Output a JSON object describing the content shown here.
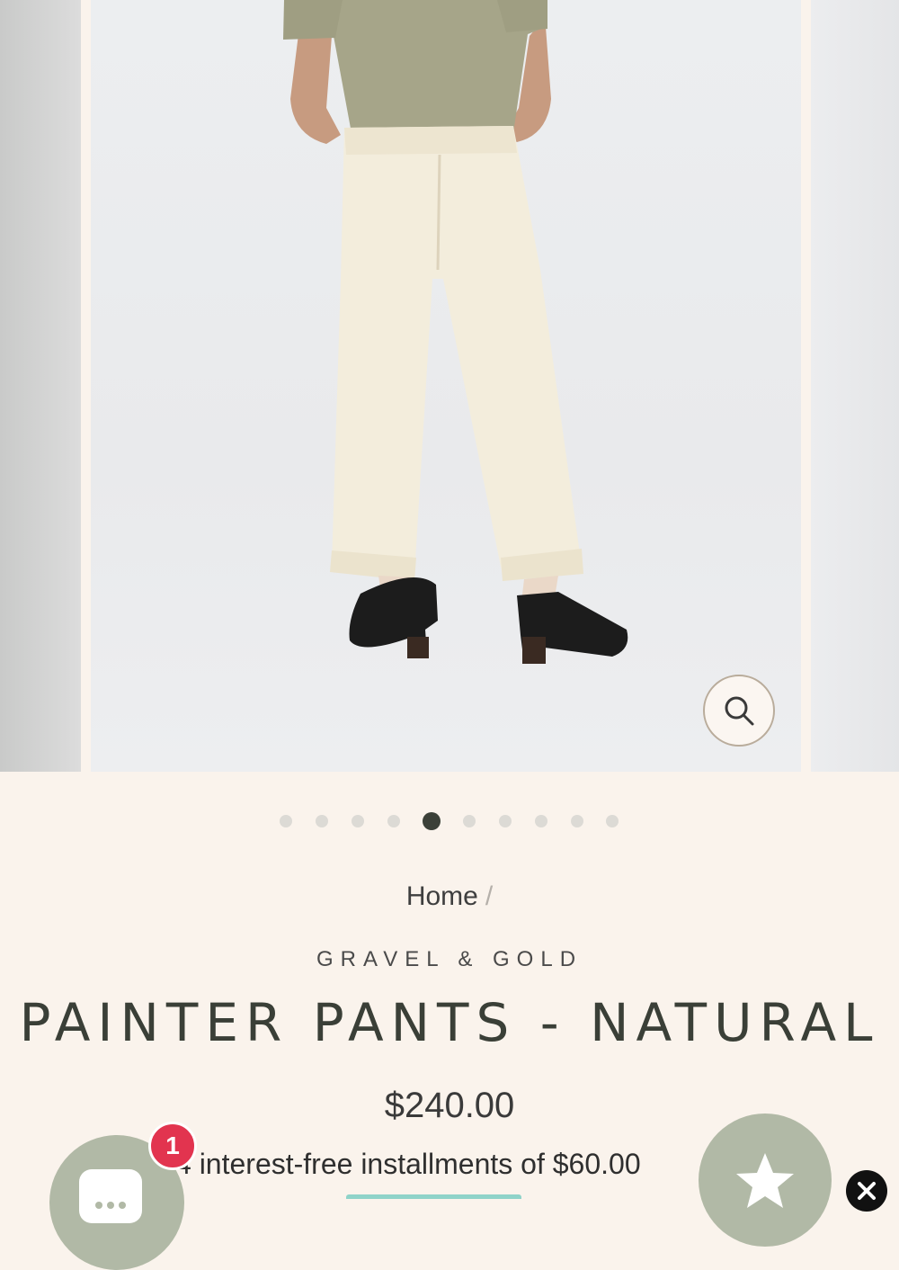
{
  "gallery": {
    "slide_count": 10,
    "active_index": 4,
    "image_subject": "model wearing natural painter pants",
    "zoom_icon": "search-icon"
  },
  "breadcrumb": {
    "home": "Home",
    "separator": "/"
  },
  "product": {
    "brand": "GRAVEL & GOLD",
    "title": "PAINTER PANTS - NATURAL",
    "price": "$240.00",
    "installments": "4 interest-free installments of $60.00"
  },
  "widgets": {
    "chat_icon": "chat-icon",
    "badge_count": "1",
    "rewards_icon": "star-icon",
    "close_icon": "close-icon"
  },
  "colors": {
    "background": "#faf3ec",
    "text_dark": "#3a3f37",
    "active_dot": "#3b4038",
    "widget_green": "#b1b9a6",
    "badge_red": "#e2344f"
  }
}
